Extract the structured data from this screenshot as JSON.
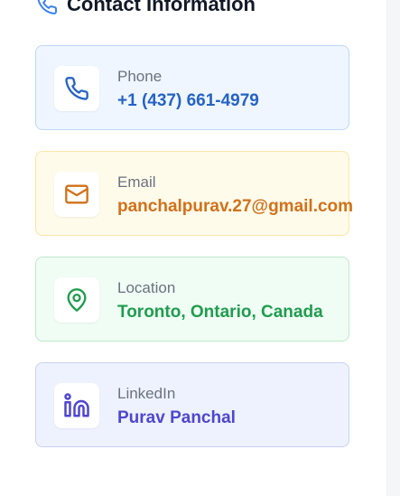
{
  "section": {
    "title": "Contact Information",
    "title_icon": "phone-icon"
  },
  "contacts": [
    {
      "label": "Phone",
      "value": "+1 (437) 661-4979",
      "icon": "phone-icon",
      "accent": "#2563c6"
    },
    {
      "label": "Email",
      "value": "panchalpurav.27@gmail.com",
      "icon": "mail-icon",
      "accent": "#d2711a"
    },
    {
      "label": "Location",
      "value": "Toronto, Ontario, Canada",
      "icon": "map-pin-icon",
      "accent": "#1f9d4e"
    },
    {
      "label": "LinkedIn",
      "value": "Purav Panchal",
      "icon": "linkedin-icon",
      "accent": "#4f46d1"
    }
  ]
}
